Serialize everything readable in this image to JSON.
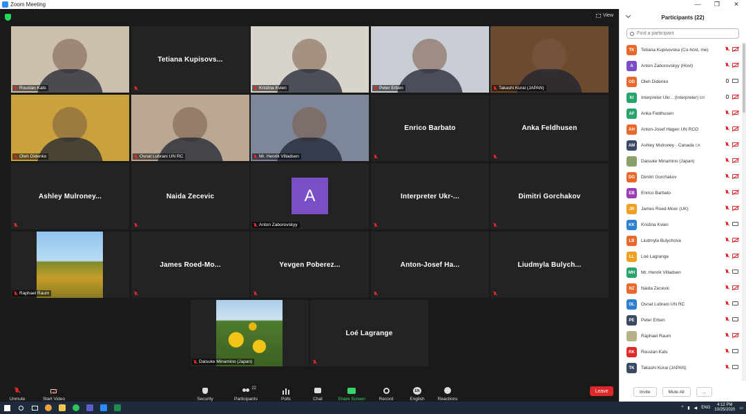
{
  "window": {
    "title": "Zoom Meeting",
    "controls": [
      "—",
      "❐",
      "✕"
    ]
  },
  "view_label": "View",
  "tiles": [
    {
      "id": "roslan",
      "caption": "Rouslan Kats",
      "kind": "video",
      "bg": "#cdbfae"
    },
    {
      "id": "tetiana",
      "bigname": "Tetiana  Kupisovs...",
      "kind": "name"
    },
    {
      "id": "kristina",
      "caption": "Kristina Kvien",
      "kind": "video",
      "bg": "#d9d4cb"
    },
    {
      "id": "peter",
      "caption": "Peter Erben",
      "kind": "video",
      "bg": "#c9cdd4"
    },
    {
      "id": "takashi",
      "caption": "Takashi Kurai (JAPAN)",
      "kind": "video",
      "bg": "#6b4a2e"
    },
    {
      "id": "oleh",
      "caption": "Oleh Didenko",
      "kind": "video",
      "bg": "#c9a23b",
      "active": true
    },
    {
      "id": "osnat",
      "caption": "Osnat Lubrani UN RC",
      "kind": "video",
      "bg": "#bba893"
    },
    {
      "id": "henrik",
      "caption": "Mr. Henrik Villadsen",
      "kind": "video",
      "bg": "#7e8799"
    },
    {
      "id": "enrico",
      "bigname": "Enrico Barbato",
      "kind": "name"
    },
    {
      "id": "anka",
      "bigname": "Anka Feldhusen",
      "kind": "name"
    },
    {
      "id": "ashley",
      "bigname": "Ashley  Mulroney...",
      "kind": "name"
    },
    {
      "id": "naida",
      "bigname": "Naida Zecevic",
      "kind": "name"
    },
    {
      "id": "anton",
      "caption": "Anton Zaborovskyy",
      "kind": "avatar",
      "letter": "A"
    },
    {
      "id": "interpreter",
      "bigname": "Interpreter  Ukr-...",
      "kind": "name"
    },
    {
      "id": "dimitri",
      "bigname": "Dimitri Gorchakov",
      "kind": "name"
    },
    {
      "id": "raphael",
      "caption": "Raphael Raum",
      "kind": "field"
    },
    {
      "id": "james",
      "bigname": "James  Roed-Mo...",
      "kind": "name"
    },
    {
      "id": "yevgen",
      "bigname": "Yevgen  Poberez...",
      "kind": "name"
    },
    {
      "id": "antonjosef",
      "bigname": "Anton-Josef  Ha...",
      "kind": "name"
    },
    {
      "id": "liudmyla",
      "bigname": "Liudmyla  Bulych...",
      "kind": "name"
    },
    {
      "id": "daisuke",
      "caption": "Daisuke Minamino (Japan)",
      "kind": "sunflower"
    },
    {
      "id": "loe",
      "bigname": "Loé Lagrange",
      "kind": "name"
    }
  ],
  "toolbar": {
    "unmute": "Unmute",
    "start_video": "Start Video",
    "security": "Security",
    "participants": "Participants",
    "participants_count": "22",
    "polls": "Polls",
    "chat": "Chat",
    "share_screen": "Share Screen",
    "record": "Record",
    "english": "English",
    "en_badge": "EN",
    "reactions": "Reactions",
    "leave": "Leave"
  },
  "panel": {
    "title": "Participants (22)",
    "search_placeholder": "Find a participant",
    "invite": "Invite",
    "mute_all": "Mute All",
    "more": "...",
    "participants": [
      {
        "initials": "TK",
        "name": "Tetiana Kupisovska (Co-host, me)",
        "color": "#e8692b",
        "mic": "off",
        "cam": "off"
      },
      {
        "initials": "A",
        "name": "Anton Zaborovskyy (Host)",
        "color": "#7a4fc6",
        "mic": "off",
        "cam": "off"
      },
      {
        "initials": "OD",
        "name": "Oleh Didenko",
        "color": "#e8692b",
        "mic": "on",
        "cam": "on"
      },
      {
        "initials": "IU",
        "name": "Interpreter Ukr... (Interpreter)",
        "tag": "EN",
        "color": "#27a36b",
        "mic": "on",
        "cam": "off"
      },
      {
        "initials": "AF",
        "name": "Anka Feldhusen",
        "color": "#27a36b",
        "mic": "off",
        "cam": "off"
      },
      {
        "initials": "AH",
        "name": "Anton-Josef Hagen UN RCO",
        "color": "#e8692b",
        "mic": "off",
        "cam": "off"
      },
      {
        "initials": "AM",
        "name": "Ashley Mulroney - Canada",
        "tag": "CA",
        "color": "#3b4a63",
        "mic": "off",
        "cam": "off"
      },
      {
        "initials": "",
        "name": "Daisuke Minamino (Japan)",
        "color": "#8aa06a",
        "mic": "off",
        "cam": "off"
      },
      {
        "initials": "DG",
        "name": "Dimitri Gorchakov",
        "color": "#e8692b",
        "mic": "off",
        "cam": "off"
      },
      {
        "initials": "EB",
        "name": "Enrico Barbato",
        "color": "#9b3fb5",
        "mic": "off",
        "cam": "off"
      },
      {
        "initials": "JR",
        "name": "James Roed-Moor (UK)",
        "color": "#f0a020",
        "mic": "off",
        "cam": "off"
      },
      {
        "initials": "KK",
        "name": "Kristina Kvien",
        "color": "#2d7fd1",
        "mic": "off",
        "cam": "on"
      },
      {
        "initials": "LB",
        "name": "Liudmyla Bulychova",
        "color": "#e8692b",
        "mic": "off",
        "cam": "off"
      },
      {
        "initials": "LL",
        "name": "Loé Lagrange",
        "color": "#f0a020",
        "mic": "off",
        "cam": "off"
      },
      {
        "initials": "MH",
        "name": "Mr. Henrik Villadsen",
        "color": "#27a36b",
        "mic": "off",
        "cam": "on"
      },
      {
        "initials": "NZ",
        "name": "Naida Zecevic",
        "color": "#e8692b",
        "mic": "off",
        "cam": "off"
      },
      {
        "initials": "OL",
        "name": "Osnat Lubrani UN RC",
        "color": "#2d7fd1",
        "mic": "off",
        "cam": "on"
      },
      {
        "initials": "PE",
        "name": "Peter Erben",
        "color": "#3b4a63",
        "mic": "off",
        "cam": "on"
      },
      {
        "initials": "",
        "name": "Raphael Raum",
        "color": "#b5b28a",
        "mic": "off",
        "cam": "off"
      },
      {
        "initials": "RK",
        "name": "Rouslan Kats",
        "color": "#e02828",
        "mic": "off",
        "cam": "on"
      },
      {
        "initials": "TK",
        "name": "Takashi Kurai (JAPAN)",
        "color": "#3b4a63",
        "mic": "off",
        "cam": "on"
      }
    ]
  },
  "taskbar": {
    "lang": "ENG",
    "time": "4:12 PM",
    "date": "10/25/2020"
  }
}
